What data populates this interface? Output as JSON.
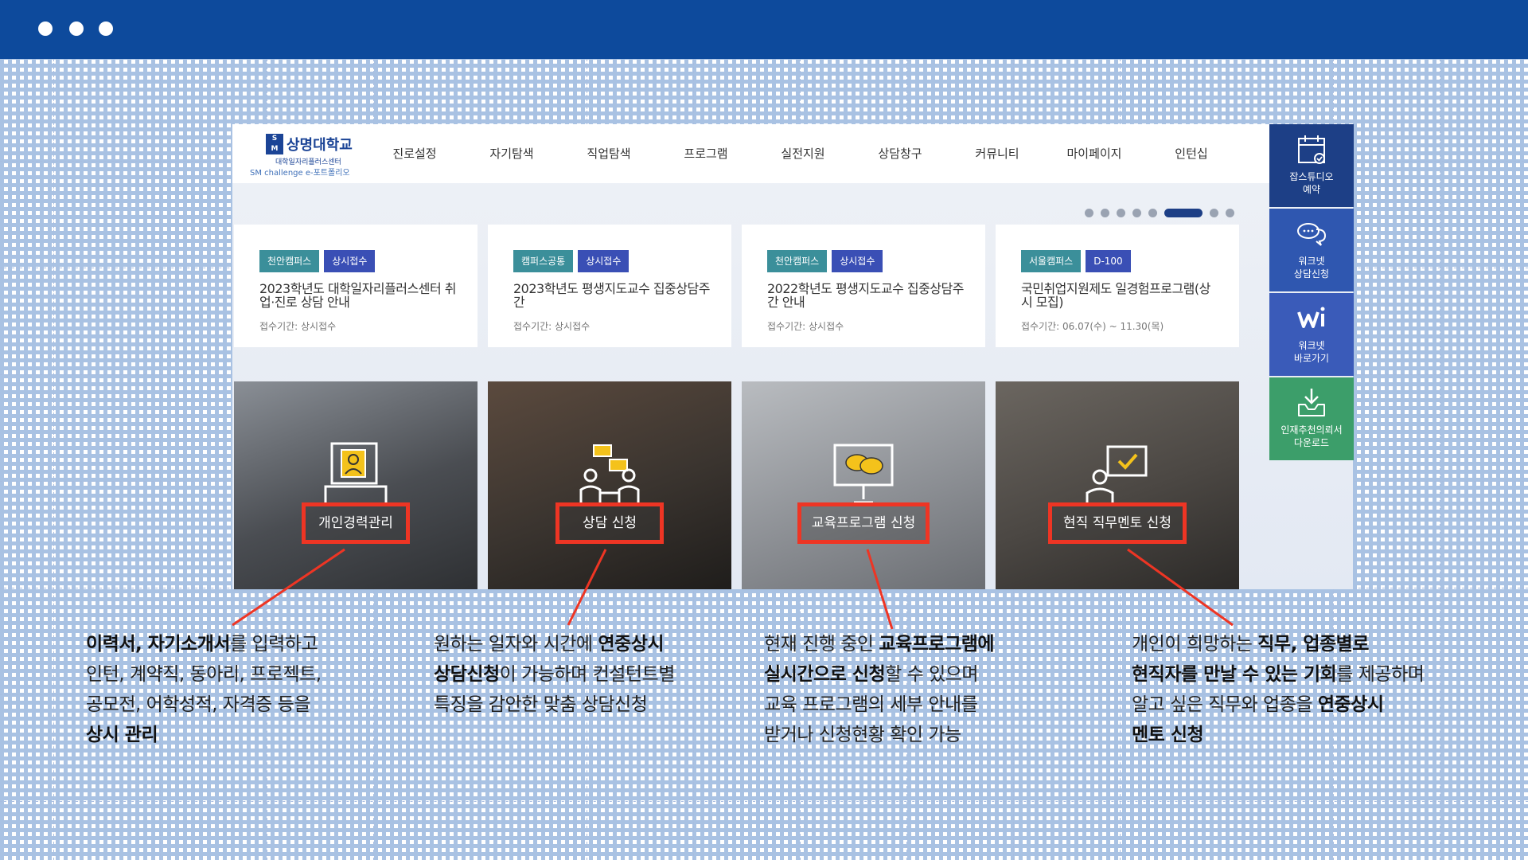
{
  "colors": {
    "top_bar": "#0d4a9c",
    "highlight_red": "#ee3524",
    "tag_campus": "#3b8f9a",
    "tag_status": "#3a4fb5",
    "quick_studio": "#1d3f86",
    "quick_counsel": "#2f57b0",
    "quick_worknet": "#3a5bb9",
    "quick_download": "#3c9e6a"
  },
  "site": {
    "logo": {
      "name": "상명대학교",
      "sub1": "대학일자리플러스센터",
      "sub2": "SM challenge e-포트폴리오"
    },
    "nav": [
      "진로설정",
      "자기탐색",
      "직업탐색",
      "프로그램",
      "실전지원",
      "상담창구",
      "커뮤니티",
      "마이페이지",
      "인턴십"
    ],
    "slider": {
      "page_count": 8,
      "active_index": 5
    },
    "notices": [
      {
        "campus": "천안캠퍼스",
        "status": "상시접수",
        "title": "2023학년도 대학일자리플러스센터 취업·진로 상담 안내",
        "period": "접수기간: 상시접수"
      },
      {
        "campus": "캠퍼스공통",
        "status": "상시접수",
        "title": "2023학년도 평생지도교수 집중상담주간",
        "period": "접수기간: 상시접수"
      },
      {
        "campus": "천안캠퍼스",
        "status": "상시접수",
        "title": "2022학년도 평생지도교수 집중상담주간 안내",
        "period": "접수기간: 상시접수"
      },
      {
        "campus": "서울캠퍼스",
        "status": "D-100",
        "title": "국민취업지원제도 일경험프로그램(상시 모집)",
        "period": "접수기간: 06.07(수) ~ 11.30(목)"
      }
    ],
    "features": [
      {
        "label": "개인경력관리",
        "icon": "resume-icon"
      },
      {
        "label": "상담 신청",
        "icon": "counseling-icon"
      },
      {
        "label": "교육프로그램 신청",
        "icon": "presentation-icon"
      },
      {
        "label": "현직 직무멘토 신청",
        "icon": "mentor-icon"
      }
    ],
    "quick_menu": [
      {
        "label": "잡스튜디오\n예약",
        "icon": "calendar-icon"
      },
      {
        "label": "워크넷\n상담신청",
        "icon": "chat-icon"
      },
      {
        "label": "워크넷\n바로가기",
        "icon": "worknet-logo-icon"
      },
      {
        "label": "인재추천의뢰서\n다운로드",
        "icon": "download-tray-icon"
      }
    ]
  },
  "callouts": [
    {
      "parts": [
        {
          "text": "이력서, 자기소개서",
          "bold": true
        },
        {
          "text": "를 입력하고\n인턴, 계약직, 동아리, 프로젝트,\n공모전, 어학성적, 자격증 등을\n",
          "bold": false
        },
        {
          "text": "상시 관리",
          "bold": true
        }
      ]
    },
    {
      "parts": [
        {
          "text": "원하는 일자와 시간에 ",
          "bold": false
        },
        {
          "text": "연중상시\n상담신청",
          "bold": true
        },
        {
          "text": "이 가능하며 컨설턴트별\n특징을 감안한 맞춤 상담신청",
          "bold": false
        }
      ]
    },
    {
      "parts": [
        {
          "text": "현재 진행 중인 ",
          "bold": false
        },
        {
          "text": "교육프로그램에\n실시간으로 신청",
          "bold": true
        },
        {
          "text": "할 수 있으며\n교육 프로그램의 세부 안내를\n받거나 신청현황 확인 가능",
          "bold": false
        }
      ]
    },
    {
      "parts": [
        {
          "text": "개인이 희망하는 ",
          "bold": false
        },
        {
          "text": "직무, 업종별로\n현직자를 만날 수 있는 기회",
          "bold": true
        },
        {
          "text": "를 제공하며\n알고 싶은 직무와 업종을 ",
          "bold": false
        },
        {
          "text": "연중상시\n멘토 신청",
          "bold": true
        }
      ]
    }
  ]
}
